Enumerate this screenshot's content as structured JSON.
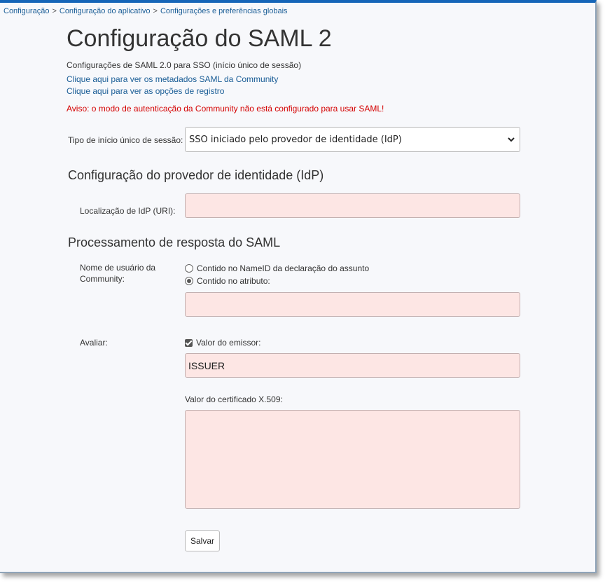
{
  "breadcrumb": {
    "items": [
      "Configuração",
      "Configuração do aplicativo",
      "Configurações e preferências globais"
    ],
    "separator": ">"
  },
  "page": {
    "title": "Configuração do SAML 2",
    "subtitle": "Configurações de SAML 2.0 para SSO (início único de sessão)",
    "metadata_link": "Clique aqui para ver os metadados SAML da Community",
    "logging_link": "Clique aqui para ver as opções de registro",
    "warning": "Aviso: o modo de autenticação da Community não está configurado para usar SAML!"
  },
  "sso": {
    "label": "Tipo de início único de sessão:",
    "selected": "SSO iniciado pelo provedor de identidade (IdP)"
  },
  "idp_section": {
    "heading": "Configuração do provedor de identidade (IdP)",
    "location_label": "Localização de IdP (URI):",
    "location_value": ""
  },
  "response_section": {
    "heading": "Processamento de resposta do SAML",
    "username_label_line1": "Nome de usuário da",
    "username_label_line2": "Community:",
    "radio_nameid": "Contido no NameID da declaração do assunto",
    "radio_attribute": "Contido no atributo:",
    "attribute_value": "",
    "evaluate_label": "Avaliar:",
    "issuer_checkbox": "Valor do emissor:",
    "issuer_value": "ISSUER",
    "certificate_label": "Valor do certificado X.509:",
    "certificate_value": ""
  },
  "actions": {
    "save": "Salvar"
  },
  "colors": {
    "accent": "#1565b8",
    "link": "#1a5d96",
    "warning": "#d40000",
    "input_bg": "#fde6e4"
  }
}
